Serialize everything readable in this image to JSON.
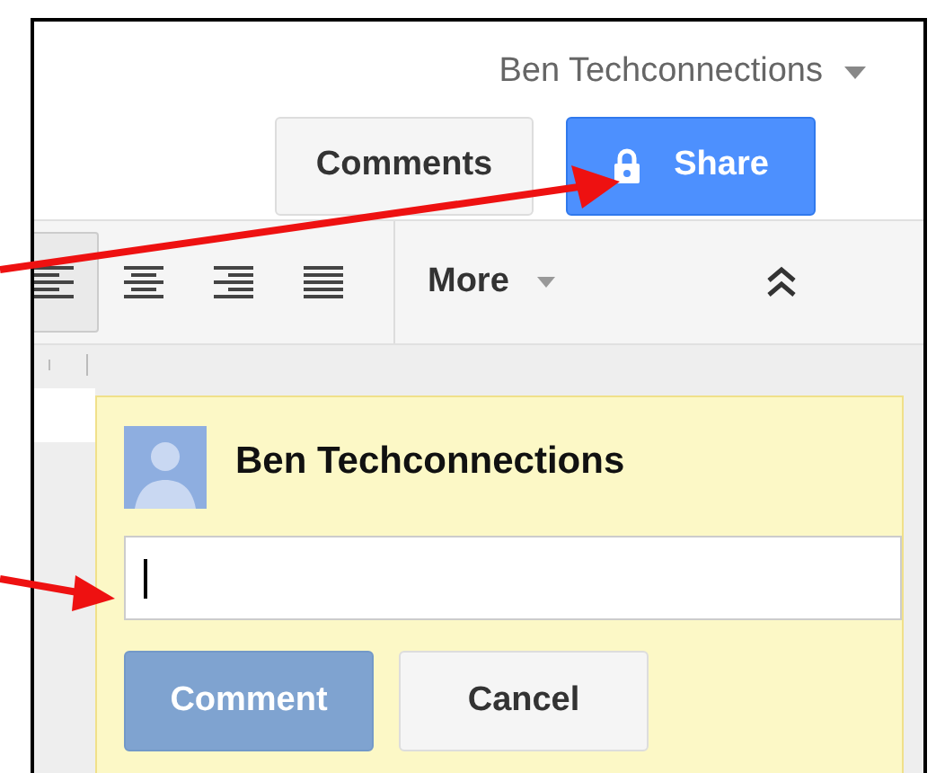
{
  "account": {
    "name": "Ben Techconnections"
  },
  "header_buttons": [
    {
      "label": "Comments",
      "kind": "plain"
    },
    {
      "label": "Share",
      "kind": "primary"
    }
  ],
  "toolbar": {
    "align_buttons": [
      {
        "kind": "left",
        "selected": true
      },
      {
        "kind": "center",
        "selected": false
      },
      {
        "kind": "right",
        "selected": false
      },
      {
        "kind": "justify",
        "selected": false
      }
    ],
    "more": "More"
  },
  "comment": {
    "author": "Ben Techconnections",
    "focused": true,
    "buttons": [
      {
        "label": "Comment",
        "kind": "primary",
        "disabled": true
      },
      {
        "label": "Cancel",
        "kind": "plain",
        "disabled": false
      }
    ]
  }
}
